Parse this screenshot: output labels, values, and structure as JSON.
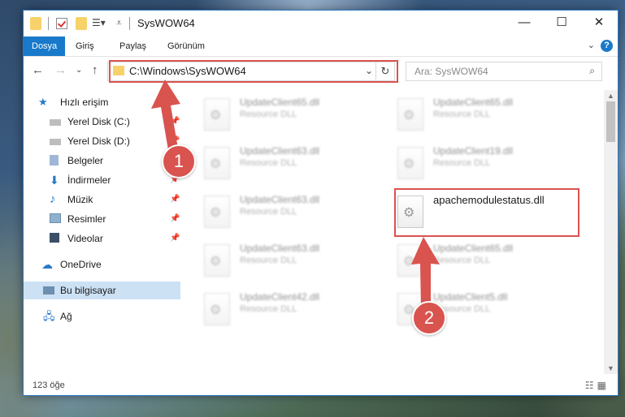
{
  "window": {
    "title": "SysWOW64",
    "minimize": "—",
    "maximize": "☐",
    "close": "✕"
  },
  "ribbon": {
    "tabs": [
      "Dosya",
      "Giriş",
      "Paylaş",
      "Görünüm"
    ],
    "help": "?"
  },
  "nav": {
    "address": "C:\\Windows\\SysWOW64",
    "search_placeholder": "Ara: SysWOW64"
  },
  "sidebar": {
    "items": [
      {
        "label": "Hızlı erişim",
        "icon": "star-icon"
      },
      {
        "label": "Yerel Disk (C:)",
        "icon": "drive-icon"
      },
      {
        "label": "Yerel Disk (D:)",
        "icon": "drive-icon"
      },
      {
        "label": "Belgeler",
        "icon": "document-icon"
      },
      {
        "label": "İndirmeler",
        "icon": "download-icon"
      },
      {
        "label": "Müzik",
        "icon": "music-icon"
      },
      {
        "label": "Resimler",
        "icon": "picture-icon"
      },
      {
        "label": "Videolar",
        "icon": "video-icon"
      },
      {
        "label": "OneDrive",
        "icon": "cloud-icon"
      },
      {
        "label": "Bu bilgisayar",
        "icon": "computer-icon"
      },
      {
        "label": "Ağ",
        "icon": "network-icon"
      }
    ]
  },
  "files": [
    {
      "name": "UpdateClient65.dll",
      "type": "Resource DLL"
    },
    {
      "name": "UpdateClient65.dll",
      "type": "Resource DLL"
    },
    {
      "name": "UpdateClient63.dll",
      "type": "Resource DLL"
    },
    {
      "name": "UpdateClient19.dll",
      "type": "Resource DLL"
    },
    {
      "name": "UpdateClient63.dll",
      "type": "Resource DLL"
    },
    {
      "name": "apachemodulestatus.dll",
      "type": ""
    },
    {
      "name": "UpdateClient63.dll",
      "type": "Resource DLL"
    },
    {
      "name": "UpdateClient65.dll",
      "type": "Resource DLL"
    },
    {
      "name": "UpdateClient42.dll",
      "type": "Resource DLL"
    },
    {
      "name": "UpdateClient5.dll",
      "type": "Resource DLL"
    }
  ],
  "status": {
    "count": "123 öğe"
  },
  "annotations": {
    "step1": "1",
    "step2": "2",
    "color": "#d9534f"
  }
}
